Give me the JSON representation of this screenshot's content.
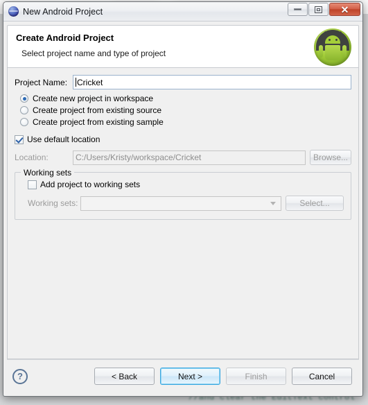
{
  "window": {
    "title": "New Android Project",
    "icon": "eclipse-globe-icon",
    "minimize_label": "",
    "restore_label": "",
    "close_label": "✕"
  },
  "header": {
    "title": "Create Android Project",
    "subtitle": "Select project name and type of project",
    "logo": "android-robot-icon"
  },
  "form": {
    "project_name_label": "Project Name:",
    "project_name_value": "Cricket",
    "project_name_placeholder": "",
    "radios": [
      {
        "label": "Create new project in workspace",
        "checked": true
      },
      {
        "label": "Create project from existing source",
        "checked": false
      },
      {
        "label": "Create project from existing sample",
        "checked": false
      }
    ],
    "use_default_location_label": "Use default location",
    "use_default_location_checked": true,
    "location_label": "Location:",
    "location_value": "C:/Users/Kristy/workspace/Cricket",
    "browse_label": "Browse..."
  },
  "working_sets": {
    "group_title": "Working sets",
    "add_checkbox_label": "Add project to working sets",
    "add_checkbox_checked": false,
    "combo_label": "Working sets:",
    "combo_value": "",
    "select_label": "Select..."
  },
  "footer": {
    "help_label": "?",
    "back_label": "< Back",
    "next_label": "Next >",
    "finish_label": "Finish",
    "cancel_label": "Cancel"
  },
  "backdrop": {
    "code_comment": "//and clear the EditText control"
  },
  "colors": {
    "accent_blue": "#2e6bb5",
    "default_button_border": "#3aa7e0",
    "android_green": "#a4ce39",
    "close_red": "#bf4429",
    "dialog_bg": "#f0f0f0"
  }
}
